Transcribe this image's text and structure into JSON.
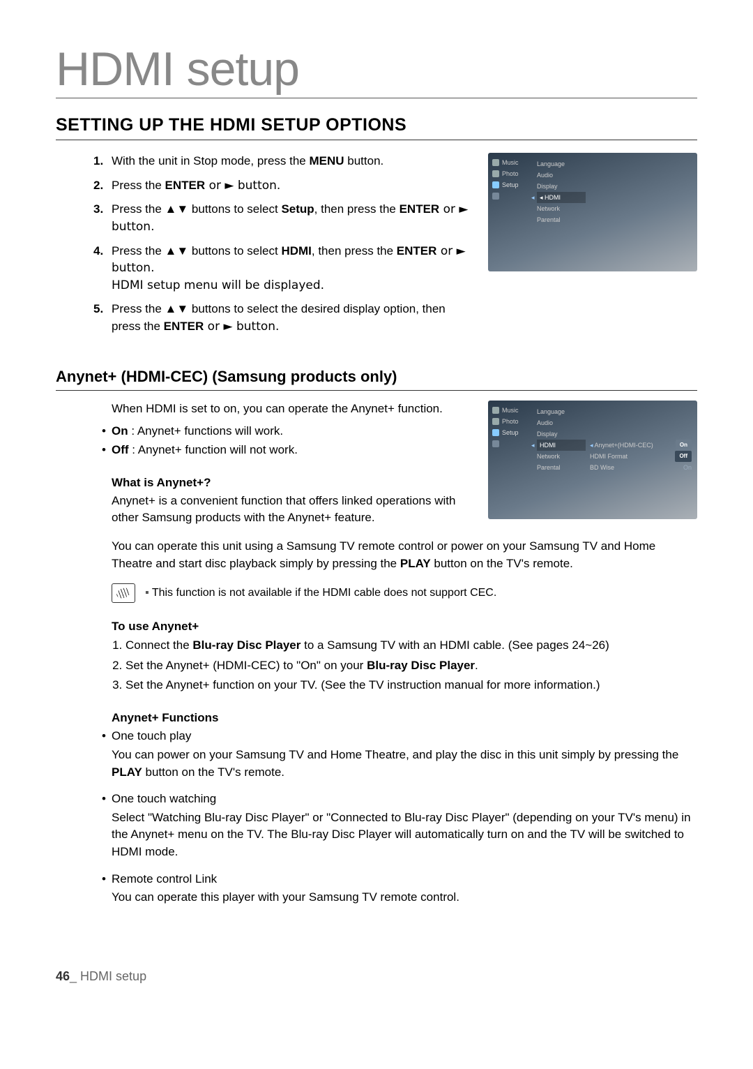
{
  "page": {
    "title": "HDMI setup",
    "section_heading": "SETTING UP THE HDMI SETUP OPTIONS",
    "footer_page": "46",
    "footer_sep": "_ ",
    "footer_title": "HDMI setup"
  },
  "steps": [
    {
      "n": "1.",
      "pre": "With the unit in Stop mode, press the ",
      "b": "MENU",
      "post": " button."
    },
    {
      "n": "2.",
      "pre": "Press the ",
      "b": "ENTER",
      "post": " or ► button."
    },
    {
      "n": "3.",
      "pre": "Press the ▲▼ buttons to select ",
      "b": "Setup",
      "post": ", then press the ",
      "b2": "ENTER",
      "post2": " or ► button."
    },
    {
      "n": "4.",
      "pre": "Press the ▲▼ buttons to select ",
      "b": "HDMI",
      "post": ", then press the ",
      "b2": "ENTER",
      "post2": " or ► button.\nHDMI setup menu will be displayed."
    },
    {
      "n": "5.",
      "pre": "Press the ▲▼ buttons to select the desired display option, then press the ",
      "b": "ENTER",
      "post": " or ► button."
    }
  ],
  "osd1": {
    "left": [
      "Music",
      "Photo",
      "Setup",
      ""
    ],
    "mid": [
      "Language",
      "Audio",
      "Display",
      "◂ HDMI",
      "Network",
      "Parental"
    ]
  },
  "anynet": {
    "heading": "Anynet+ (HDMI-CEC) (Samsung products only)",
    "intro": "When HDMI is set to on, you can operate the Anynet+ function.",
    "bullets": [
      {
        "b": "On",
        "t": " : Anynet+ functions will work."
      },
      {
        "b": "Off",
        "t": " : Anynet+ function will not work."
      }
    ],
    "what_h": "What is Anynet+?",
    "what_p": "Anynet+ is a convenient function that offers linked operations with other Samsung products with the Anynet+ feature.",
    "para": "You can operate this unit using a Samsung TV remote control or power on your Samsung TV and Home Theatre and start disc playback simply by pressing the ",
    "para_b": "PLAY",
    "para_post": " button on the TV's remote.",
    "note": "This function is not available if the HDMI cable does not support CEC.",
    "use_h": "To use Anynet+",
    "use_steps": [
      {
        "pre": "Connect the ",
        "b": "Blu-ray Disc Player",
        "post": " to a Samsung TV with an HDMI cable. (See pages 24~26)"
      },
      {
        "pre": "Set the Anynet+ (HDMI-CEC) to \"On\" on your ",
        "b": "Blu-ray Disc Player",
        "post": "."
      },
      {
        "pre": "Set the Anynet+ function on your TV. (See the TV instruction manual for more information.)",
        "b": "",
        "post": ""
      }
    ],
    "func_h": "Anynet+ Functions",
    "funcs": [
      {
        "name": "One touch play",
        "desc_pre": "You can power on your Samsung TV and Home Theatre, and play the disc in this unit simply by pressing the ",
        "b": "PLAY",
        "desc_post": " button on the TV's remote."
      },
      {
        "name": "One touch watching",
        "desc_pre": "Select \"Watching Blu-ray Disc Player\" or \"Connected to Blu-ray Disc Player\" (depending on your TV's menu) in the Anynet+ menu on the TV. The Blu-ray Disc Player will automatically turn on and the TV will be switched to HDMI mode.",
        "b": "",
        "desc_post": ""
      },
      {
        "name": "Remote control Link",
        "desc_pre": "You can operate this player with your Samsung TV remote control.",
        "b": "",
        "desc_post": ""
      }
    ]
  },
  "osd2": {
    "left": [
      "Music",
      "Photo",
      "Setup",
      ""
    ],
    "mid": [
      "Language",
      "Audio",
      "Display",
      "HDMI",
      "Network",
      "Parental"
    ],
    "right": [
      {
        "l": "Anynet+(HDMI-CEC)",
        "v": "On",
        "sel": true
      },
      {
        "l": "HDMI Format",
        "v": "Off",
        "sel": false
      },
      {
        "l": "BD Wise",
        "v": "On",
        "sel": false
      }
    ]
  }
}
